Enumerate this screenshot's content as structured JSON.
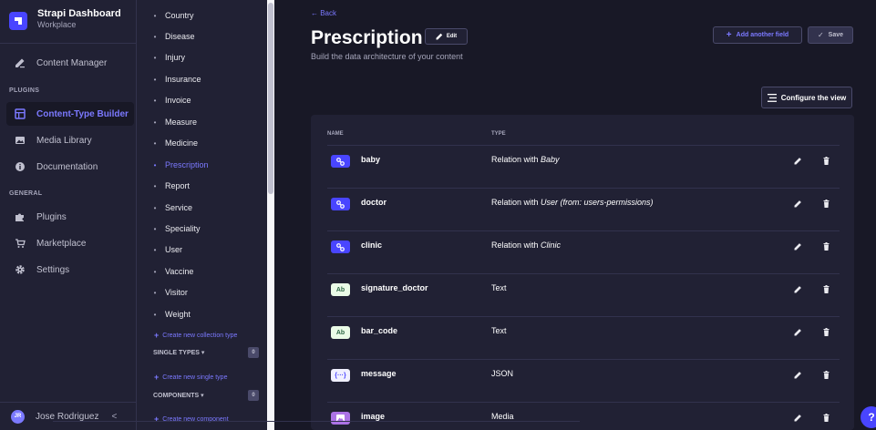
{
  "brand": {
    "title": "Strapi Dashboard",
    "subtitle": "Workplace"
  },
  "mainnav": {
    "content_manager": "Content Manager",
    "plugins_section": "PLUGINS",
    "content_type_builder": "Content-Type Builder",
    "media_library": "Media Library",
    "documentation": "Documentation",
    "general_section": "GENERAL",
    "plugins": "Plugins",
    "marketplace": "Marketplace",
    "settings": "Settings"
  },
  "user": {
    "initials": "JR",
    "name": "Jose Rodriguez",
    "collapse": "<"
  },
  "subnav": {
    "collection_types": [
      "Country",
      "Disease",
      "Injury",
      "Insurance",
      "Invoice",
      "Measure",
      "Medicine",
      "Prescription",
      "Report",
      "Service",
      "Speciality",
      "User",
      "Vaccine",
      "Visitor",
      "Weight"
    ],
    "active": "Prescription",
    "create_collection": "Create new collection type",
    "single_types_label": "SINGLE TYPES",
    "single_types_count": "0",
    "create_single": "Create new single type",
    "components_label": "COMPONENTS",
    "components_count": "0",
    "create_component": "Create new component"
  },
  "header": {
    "back": "← Back",
    "title": "Prescription",
    "edit": "Edit",
    "subtitle": "Build the data architecture of your content",
    "add_field": "Add another field",
    "save": "Save",
    "configure": "Configure the view"
  },
  "table": {
    "col_name": "NAME",
    "col_type": "TYPE",
    "rows": [
      {
        "icon": "relation-icon",
        "name": "baby",
        "type_prefix": "Relation with ",
        "type_target": "Baby"
      },
      {
        "icon": "relation-icon",
        "name": "doctor",
        "type_prefix": "Relation with ",
        "type_target": "User (from: users-permissions)"
      },
      {
        "icon": "relation-icon",
        "name": "clinic",
        "type_prefix": "Relation with ",
        "type_target": "Clinic"
      },
      {
        "icon": "text-icon",
        "icon_text": "Ab",
        "name": "signature_doctor",
        "type_prefix": "Text",
        "type_target": ""
      },
      {
        "icon": "text-icon",
        "icon_text": "Ab",
        "name": "bar_code",
        "type_prefix": "Text",
        "type_target": ""
      },
      {
        "icon": "json-icon",
        "icon_text": "{···}",
        "name": "message",
        "type_prefix": "JSON",
        "type_target": ""
      },
      {
        "icon": "media-icon",
        "name": "image",
        "type_prefix": "Media",
        "type_target": ""
      }
    ]
  },
  "help": "?",
  "colors": {
    "accent": "#7b79ff",
    "primary": "#4945ff",
    "bg": "#181826",
    "panel": "#212134",
    "border": "#32324d",
    "text_green": "#5cb176",
    "relation_bg": "#4945ff"
  }
}
